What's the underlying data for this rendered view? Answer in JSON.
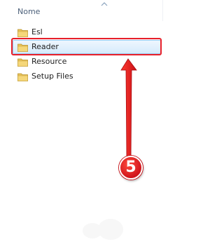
{
  "header": {
    "name_column": "Nome",
    "sort_direction": "ascending"
  },
  "items": [
    {
      "label": "Esl",
      "icon": "folder-icon",
      "selected": false
    },
    {
      "label": "Reader",
      "icon": "folder-icon",
      "selected": true
    },
    {
      "label": "Resource",
      "icon": "folder-icon",
      "selected": false
    },
    {
      "label": "Setup Files",
      "icon": "folder-icon",
      "selected": false
    }
  ],
  "annotation": {
    "step_number": "5",
    "color": "#e8202a"
  },
  "colors": {
    "selection_border": "#9cc9ee",
    "selection_fill": "#d6ebfc",
    "folder": "#e8c35a",
    "header_text": "#4c607a"
  }
}
